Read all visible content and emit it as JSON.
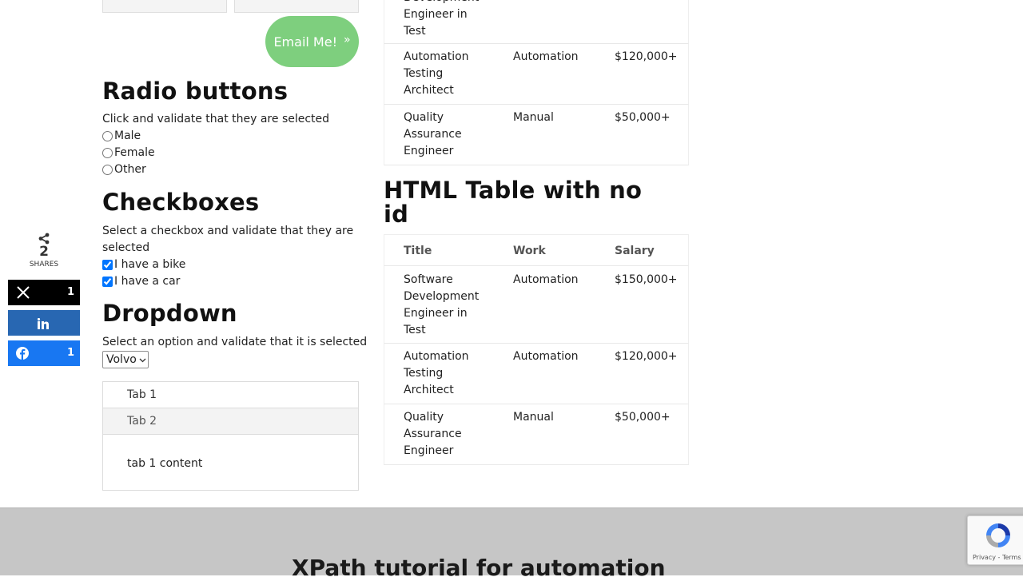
{
  "contact": {
    "email_button_label": "Email Me!",
    "email_button_chevron": "»"
  },
  "radio_section": {
    "heading": "Radio buttons",
    "description": "Click and validate that they are selected",
    "options": [
      {
        "label": "Male",
        "checked": false
      },
      {
        "label": "Female",
        "checked": false
      },
      {
        "label": "Other",
        "checked": false
      }
    ]
  },
  "checkbox_section": {
    "heading": "Checkboxes",
    "description_line1": "Select a checkbox and validate that they are",
    "description_line2": "selected",
    "options": [
      {
        "label": "I have a bike",
        "checked": true
      },
      {
        "label": "I have a car",
        "checked": true
      }
    ]
  },
  "dropdown_section": {
    "heading": "Dropdown",
    "description": "Select an option and validate that it is selected",
    "selected_value": "Volvo"
  },
  "tabs": {
    "items": [
      {
        "label": "Tab 1",
        "active": true
      },
      {
        "label": "Tab 2",
        "active": false
      }
    ],
    "content": "tab 1 content"
  },
  "share": {
    "count": "2",
    "label": "SHARES",
    "buttons": [
      {
        "network": "x",
        "icon": "x-logo-icon",
        "count": "1",
        "color": "#000000"
      },
      {
        "network": "linkedin",
        "icon": "linkedin-icon",
        "count": "",
        "color": "#2867b2"
      },
      {
        "network": "facebook",
        "icon": "facebook-icon",
        "count": "1",
        "color": "#1877f2"
      }
    ]
  },
  "top_table": {
    "partial_row": {
      "title_lines": [
        "Development",
        "Engineer in",
        "Test"
      ]
    },
    "rows": [
      {
        "title_lines": [
          "Automation",
          "Testing",
          "Architect"
        ],
        "work": "Automation",
        "salary": "$120,000+"
      },
      {
        "title_lines": [
          "Quality",
          "Assurance",
          "Engineer"
        ],
        "work": "Manual",
        "salary": "$50,000+"
      }
    ]
  },
  "no_id_table": {
    "heading_line1": "HTML Table with no",
    "heading_line2": "id",
    "headers": [
      "Title",
      "Work",
      "Salary"
    ],
    "rows": [
      {
        "title_lines": [
          "Software",
          "Development",
          "Engineer in",
          "Test"
        ],
        "work": "Automation",
        "salary": "$150,000+"
      },
      {
        "title_lines": [
          "Automation",
          "Testing",
          "Architect"
        ],
        "work": "Automation",
        "salary": "$120,000+"
      },
      {
        "title_lines": [
          "Quality",
          "Assurance",
          "Engineer"
        ],
        "work": "Manual",
        "salary": "$50,000+"
      }
    ]
  },
  "footer": {
    "title": "XPath tutorial for automation"
  },
  "recaptcha": {
    "privacy_label": "Privacy",
    "separator": " - ",
    "terms_label": "Terms"
  },
  "colors": {
    "email_button": "#7ecf7e",
    "footer_bg": "#c6c6c6"
  }
}
